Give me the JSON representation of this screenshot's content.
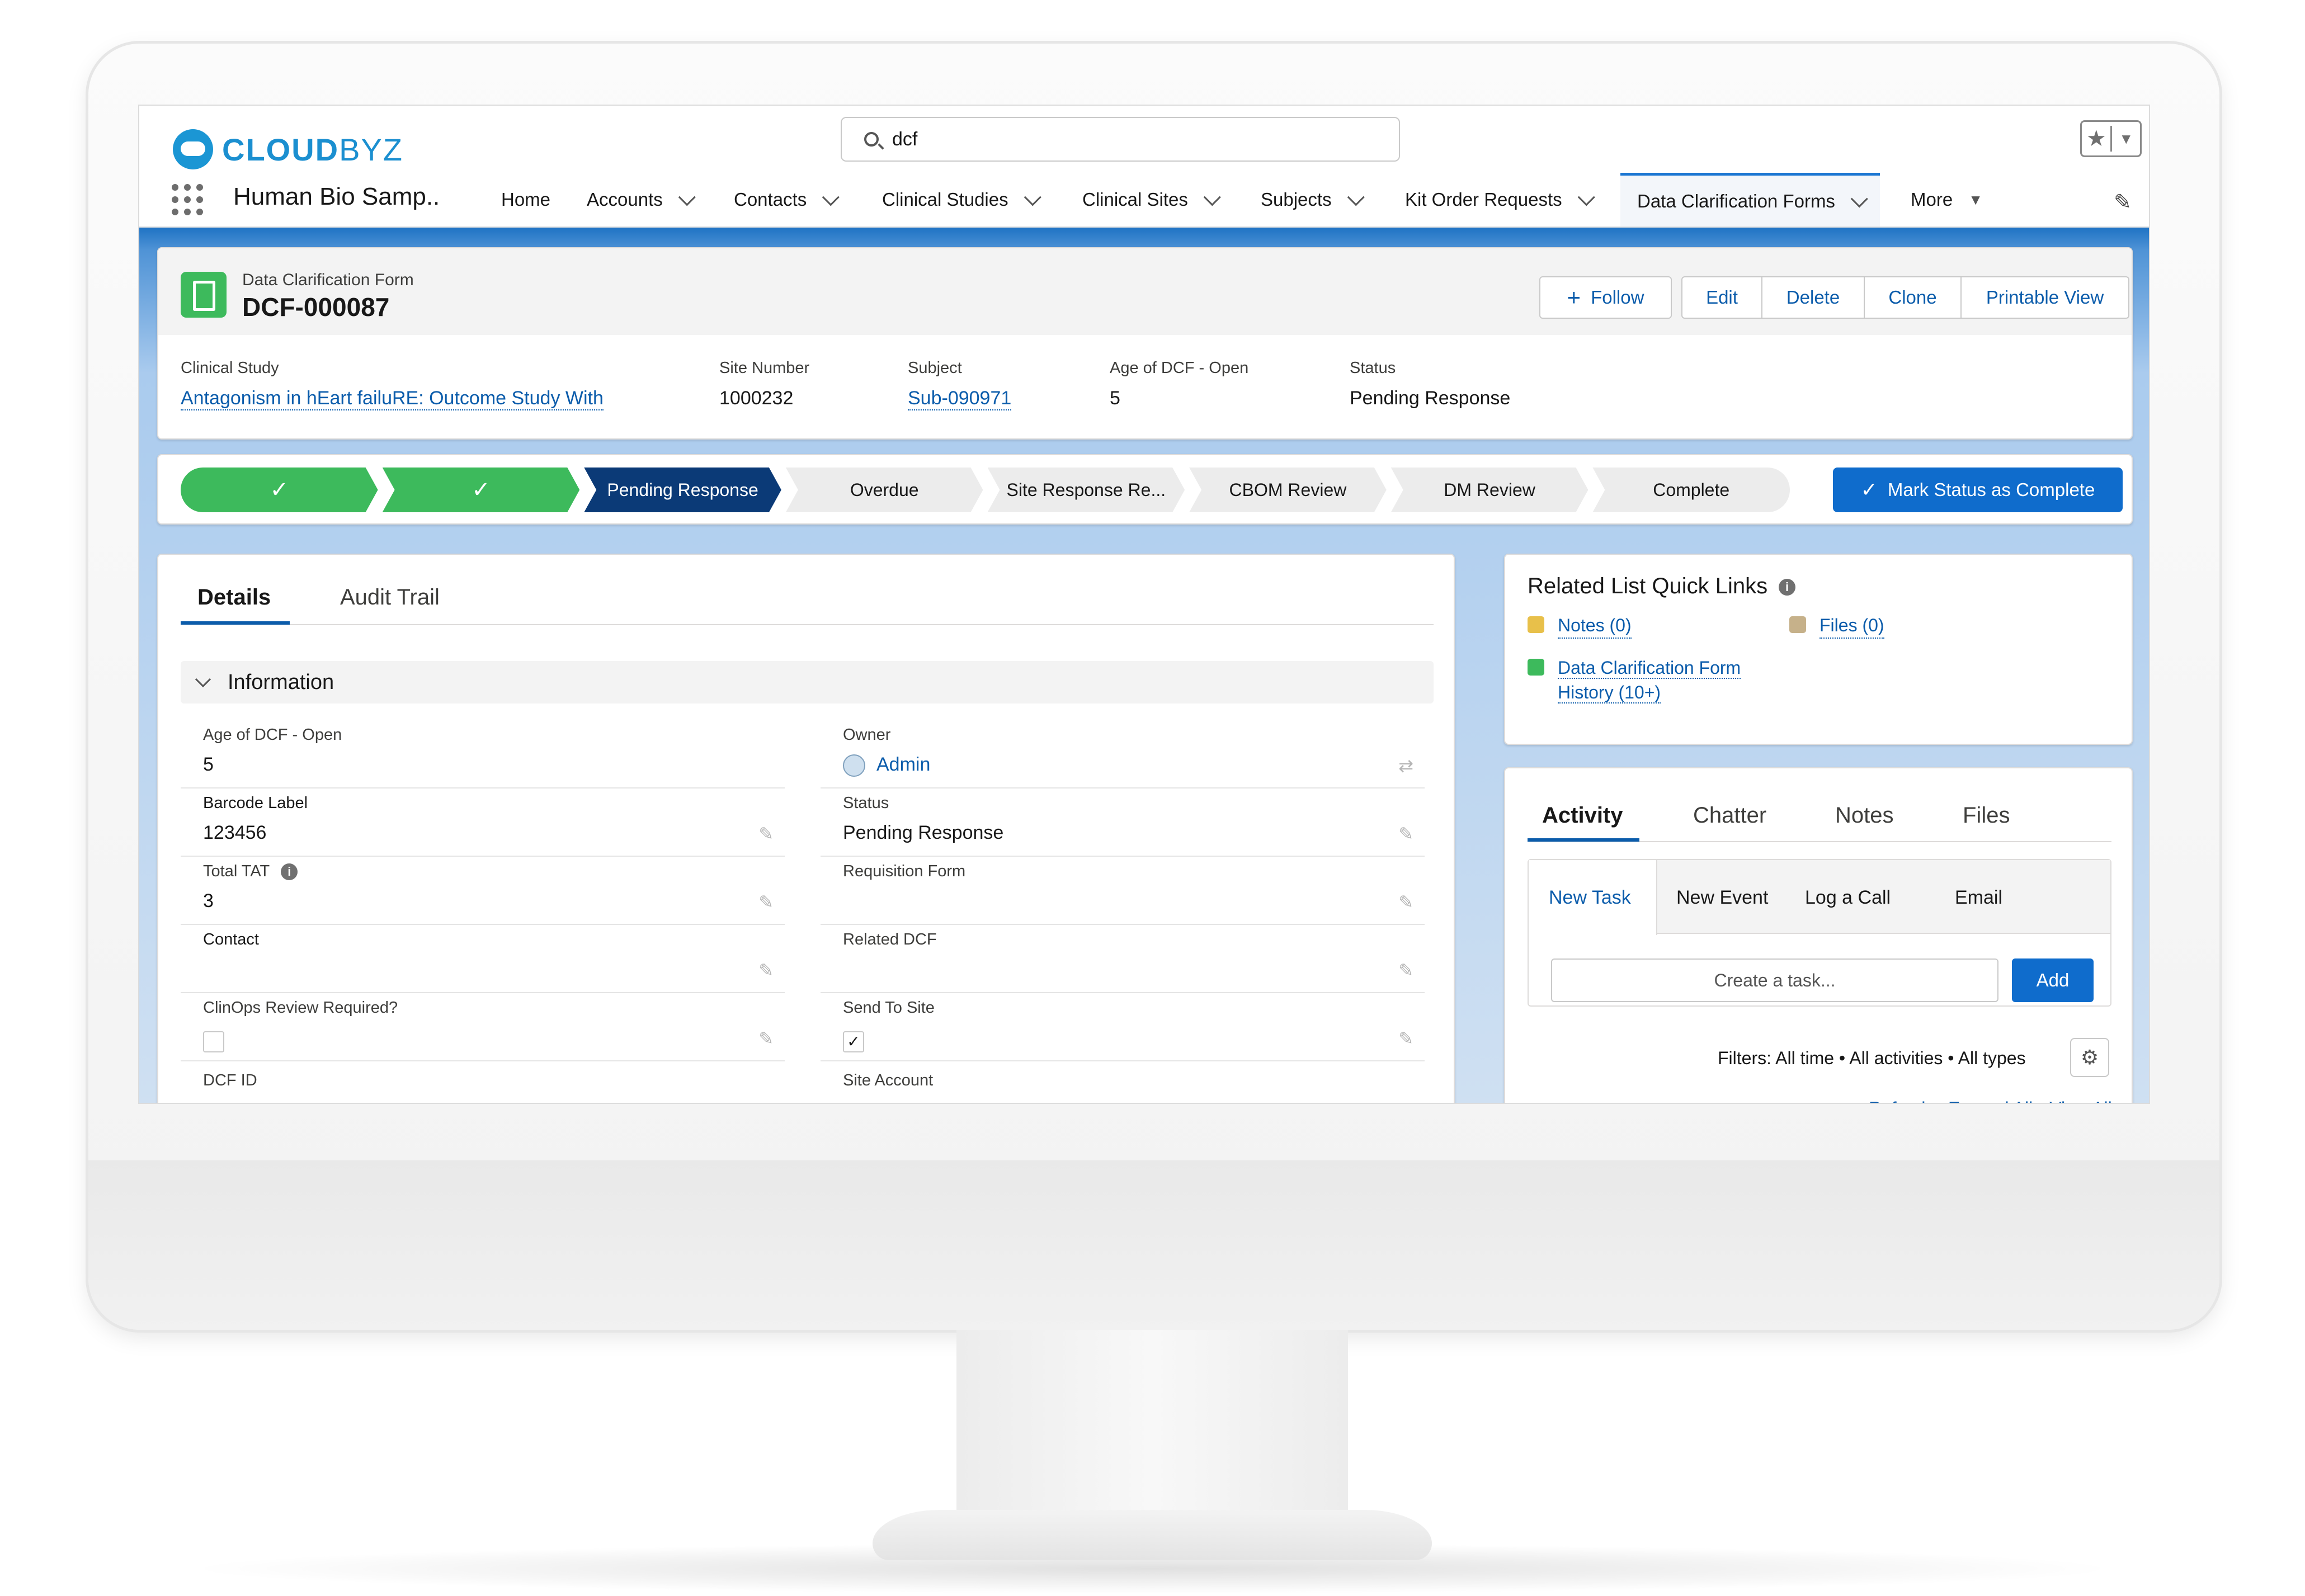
{
  "header": {
    "logo_bold": "CLOUD",
    "logo_light": "BYZ",
    "search_value": "dcf",
    "app_name": "Human Bio Samp..",
    "icons": {
      "favorites": "star-icon",
      "add": "plus-icon",
      "help": "question-icon",
      "setup": "gear-icon",
      "notifications": "bell-icon",
      "user": "avatar-icon"
    }
  },
  "nav": {
    "tabs": [
      {
        "label": "Home"
      },
      {
        "label": "Accounts"
      },
      {
        "label": "Contacts"
      },
      {
        "label": "Clinical Studies"
      },
      {
        "label": "Clinical Sites"
      },
      {
        "label": "Subjects"
      },
      {
        "label": "Kit Order Requests"
      },
      {
        "label": "Data Clarification Forms"
      },
      {
        "label": "More"
      }
    ],
    "active_tab": "Data Clarification Forms"
  },
  "record": {
    "object_label": "Data Clarification Form",
    "name": "DCF-000087",
    "actions": {
      "follow": "Follow",
      "edit": "Edit",
      "delete": "Delete",
      "clone": "Clone",
      "printable": "Printable View"
    },
    "highlights": {
      "study_label": "Clinical Study",
      "study_value": "Antagonism in hEart failuRE: Outcome Study With",
      "site_label": "Site Number",
      "site_value": "1000232",
      "subject_label": "Subject",
      "subject_value": "Sub-090971",
      "age_label": "Age of DCF - Open",
      "age_value": "5",
      "status_label": "Status",
      "status_value": "Pending Response"
    }
  },
  "path": {
    "steps": [
      "✓",
      "✓",
      "Pending Response",
      "Overdue",
      "Site Response Re...",
      "CBOM Review",
      "DM Review",
      "Complete"
    ],
    "current_index": 2,
    "mark_button": "Mark Status as Complete"
  },
  "details": {
    "tabs": {
      "details": "Details",
      "audit": "Audit Trail"
    },
    "section": "Information",
    "fields": {
      "age_label": "Age of DCF - Open",
      "age_value": "5",
      "owner_label": "Owner",
      "owner_value": "Admin",
      "barcode_label": "Barcode Label",
      "barcode_value": "123456",
      "status_label": "Status",
      "status_value": "Pending Response",
      "tat_label": "Total TAT",
      "tat_value": "3",
      "req_label": "Requisition Form",
      "req_value": "",
      "contact_label": "Contact",
      "contact_value": "",
      "related_label": "Related DCF",
      "related_value": "",
      "clinops_label": "ClinOps Review Required?",
      "clinops_checked": false,
      "send_label": "Send To Site",
      "send_checked": true,
      "dcfid_label": "DCF ID",
      "siteacct_label": "Site Account"
    }
  },
  "quick_links": {
    "title": "Related List Quick Links",
    "notes": "Notes (0)",
    "files": "Files (0)",
    "history_line1": "Data Clarification Form",
    "history_line2": "History (10+)",
    "colors": {
      "notes": "#e8c04a",
      "files": "#c6b18a",
      "history": "#3dba5c"
    }
  },
  "activity": {
    "tabs": {
      "activity": "Activity",
      "chatter": "Chatter",
      "notes": "Notes",
      "files": "Files"
    },
    "subtabs": {
      "task": "New Task",
      "event": "New Event",
      "call": "Log a Call",
      "email": "Email"
    },
    "task_placeholder": "Create a task...",
    "add_label": "Add",
    "filters": "Filters: All time • All activities • All types",
    "links": {
      "refresh": "Refresh",
      "expand": "Expand All",
      "view": "View All"
    }
  }
}
